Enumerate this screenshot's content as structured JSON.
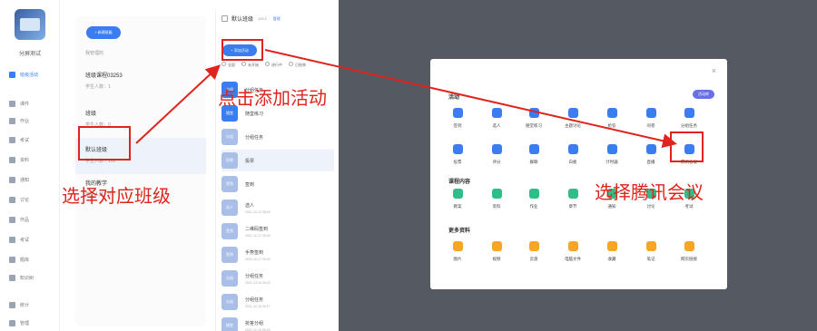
{
  "sidebar": {
    "user_name": "分屏测试",
    "items": [
      {
        "label": "班级活动",
        "icon": "grid-icon",
        "active": true
      },
      {
        "label": "课件",
        "icon": "file-icon",
        "active": false
      },
      {
        "label": "作业",
        "icon": "book-icon",
        "active": false
      },
      {
        "label": "考试",
        "icon": "exam-icon",
        "active": false
      },
      {
        "label": "资料",
        "icon": "folder-icon",
        "active": false
      },
      {
        "label": "通知",
        "icon": "bell-icon",
        "active": false
      },
      {
        "label": "讨论",
        "icon": "chat-icon",
        "active": false
      },
      {
        "label": "作品",
        "icon": "gallery-icon",
        "active": false
      },
      {
        "label": "考试",
        "icon": "test-icon",
        "active": false
      },
      {
        "label": "题库",
        "icon": "bank-icon",
        "active": false
      },
      {
        "label": "知识树",
        "icon": "tree-icon",
        "active": false
      },
      {
        "label": "统计",
        "icon": "chart-icon",
        "active": false
      },
      {
        "label": "管理",
        "icon": "gear-icon",
        "active": false
      }
    ]
  },
  "class_panel": {
    "new_class_label": "+ 新建班级",
    "managed_label": "我管理的",
    "classes": [
      {
        "name": "班级课程03253",
        "count": "学生人数：1"
      },
      {
        "name": "班级",
        "count": "学生人数：0"
      },
      {
        "name": "默认班级",
        "count": "学生人数：100"
      },
      {
        "name": "我的教学",
        "count": "学生人数：0"
      }
    ]
  },
  "activity_panel": {
    "title": "默认班级",
    "member_count": "100人",
    "manage_label": "管理",
    "add_activity_label": "+ 添加活动",
    "filters": [
      "全部",
      "未开始",
      "进行中",
      "已结束"
    ],
    "rows": [
      {
        "badge": "分组",
        "t1": "分组任务",
        "t2": "",
        "color": "#3b7df0"
      },
      {
        "badge": "随堂",
        "t1": "随堂练习",
        "t2": "",
        "color": "#3b7df0"
      },
      {
        "badge": "分组",
        "t1": "分组任务",
        "t2": "",
        "color": "#a9bfe8"
      },
      {
        "badge": "投票",
        "t1": "投票",
        "t2": "",
        "color": "#a9bfe8"
      },
      {
        "badge": "签到",
        "t1": "签到",
        "t2": "",
        "color": "#a9bfe8"
      },
      {
        "badge": "选人",
        "t1": "选人",
        "t2": "2021-12-12 08:00",
        "color": "#a9bfe8"
      },
      {
        "badge": "签到",
        "t1": "二维码签到",
        "t2": "2021-12-17 09:40",
        "color": "#a9bfe8"
      },
      {
        "badge": "签到",
        "t1": "手势签到",
        "t2": "2021-12-17 09:40",
        "color": "#a9bfe8"
      },
      {
        "badge": "分组",
        "t1": "分组任务",
        "t2": "2021-12-16 09:20",
        "color": "#a9bfe8"
      },
      {
        "badge": "分组",
        "t1": "分组任务",
        "t2": "2021-12-16 09:27",
        "color": "#a9bfe8"
      },
      {
        "badge": "随堂",
        "t1": "抢答分组",
        "t2": "2021-12-15 09:20",
        "color": "#a9bfe8"
      }
    ]
  },
  "modal": {
    "close": "×",
    "section_activity": "活动",
    "activity_tag": "活动库",
    "section_course": "课程内容",
    "section_more": "更多资料",
    "activities": [
      {
        "label": "签到",
        "color": "#3b7df0"
      },
      {
        "label": "选人",
        "color": "#3b7df0"
      },
      {
        "label": "随堂练习",
        "color": "#3b7df0"
      },
      {
        "label": "主题讨论",
        "color": "#3b7df0"
      },
      {
        "label": "抢答",
        "color": "#3b7df0"
      },
      {
        "label": "问卷",
        "color": "#3b7df0"
      },
      {
        "label": "分组任务",
        "color": "#3b7df0"
      },
      {
        "label": "投票",
        "color": "#3b7df0"
      },
      {
        "label": "评分",
        "color": "#3b7df0"
      },
      {
        "label": "群聊",
        "color": "#3b7df0"
      },
      {
        "label": "白板",
        "color": "#3b7df0"
      },
      {
        "label": "计时器",
        "color": "#3b7df0"
      },
      {
        "label": "直播",
        "color": "#3b7df0"
      },
      {
        "label": "腾讯会议",
        "color": "#3b7df0"
      }
    ],
    "course": [
      {
        "label": "教案",
        "color": "#2dbf87"
      },
      {
        "label": "资料",
        "color": "#2dbf87"
      },
      {
        "label": "作业",
        "color": "#2dbf87"
      },
      {
        "label": "章节",
        "color": "#2dbf87"
      },
      {
        "label": "通知",
        "color": "#2dbf87"
      },
      {
        "label": "讨论",
        "color": "#2dbf87"
      },
      {
        "label": "考试",
        "color": "#2dbf87"
      }
    ],
    "more": [
      {
        "label": "图片",
        "color": "#f5a623"
      },
      {
        "label": "视频",
        "color": "#f5a623"
      },
      {
        "label": "云盘",
        "color": "#f5a623"
      },
      {
        "label": "电脑文件",
        "color": "#f5a623"
      },
      {
        "label": "收藏",
        "color": "#f5a623"
      },
      {
        "label": "笔记",
        "color": "#f5a623"
      },
      {
        "label": "网页链接",
        "color": "#f5a623"
      }
    ]
  },
  "annotations": {
    "select_class": "选择对应班级",
    "add_activity": "点击添加活动",
    "select_tencent": "选择腾讯会议",
    "color": "#e0231c"
  }
}
